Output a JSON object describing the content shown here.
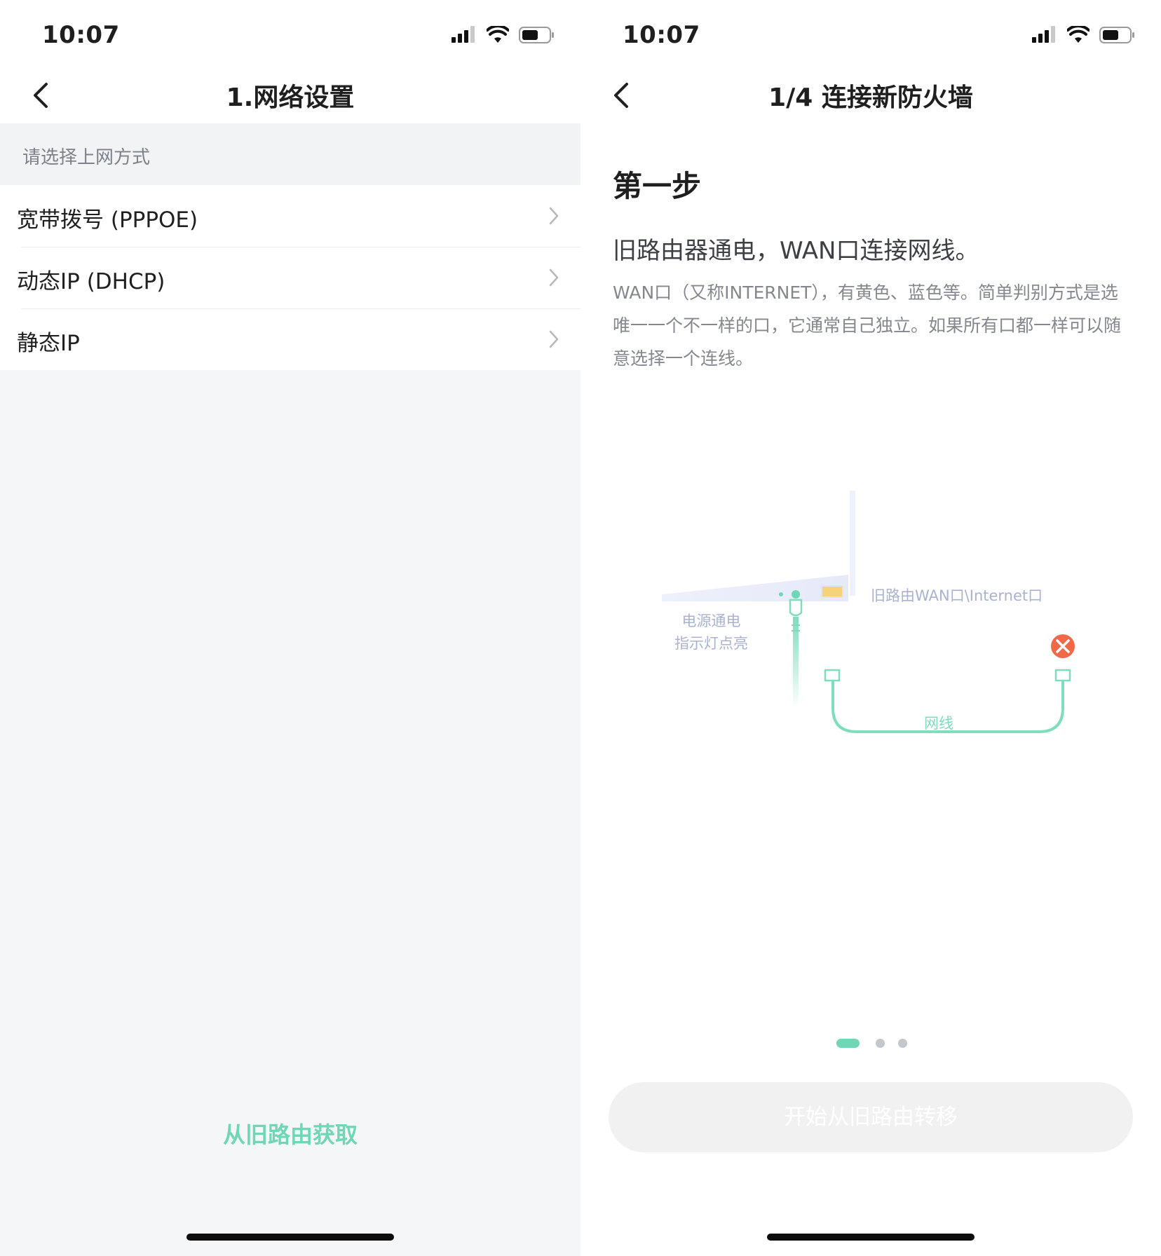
{
  "left": {
    "status": {
      "time": "10:07"
    },
    "nav": {
      "title": "1.网络设置",
      "back_icon": "chevron-left-icon"
    },
    "section_label": "请选择上网方式",
    "items": [
      {
        "label": "宽带拨号 (PPPOE)"
      },
      {
        "label": "动态IP (DHCP)"
      },
      {
        "label": "静态IP"
      }
    ],
    "action_link": "从旧路由获取"
  },
  "right": {
    "status": {
      "time": "10:07"
    },
    "nav": {
      "title": "1/4 连接新防火墙",
      "back_icon": "chevron-left-icon"
    },
    "step_title": "第一步",
    "step_subtitle": "旧路由器通电，WAN口连接网线。",
    "step_description": "WAN口（又称INTERNET），有黄色、蓝色等。简单判别方式是选唯一一个不一样的口，它通常自己独立。如果所有口都一样可以随意选择一个连线。",
    "illustration": {
      "power_label_line1": "电源通电",
      "power_label_line2": "指示灯点亮",
      "wan_label": "旧路由WAN口\\Internet口",
      "cable_label": "网线",
      "error_icon": "close-circle-icon"
    },
    "pager": {
      "total": 3,
      "active": 1
    },
    "primary_button": "开始从旧路由转移"
  },
  "colors": {
    "accent": "#6fd7b5",
    "error": "#f06a4a",
    "port_yellow": "#f5d37a",
    "router_body": "#eef0fb",
    "label_blue": "#a9b3cf",
    "button_disabled_bg": "#f1f1f2"
  }
}
